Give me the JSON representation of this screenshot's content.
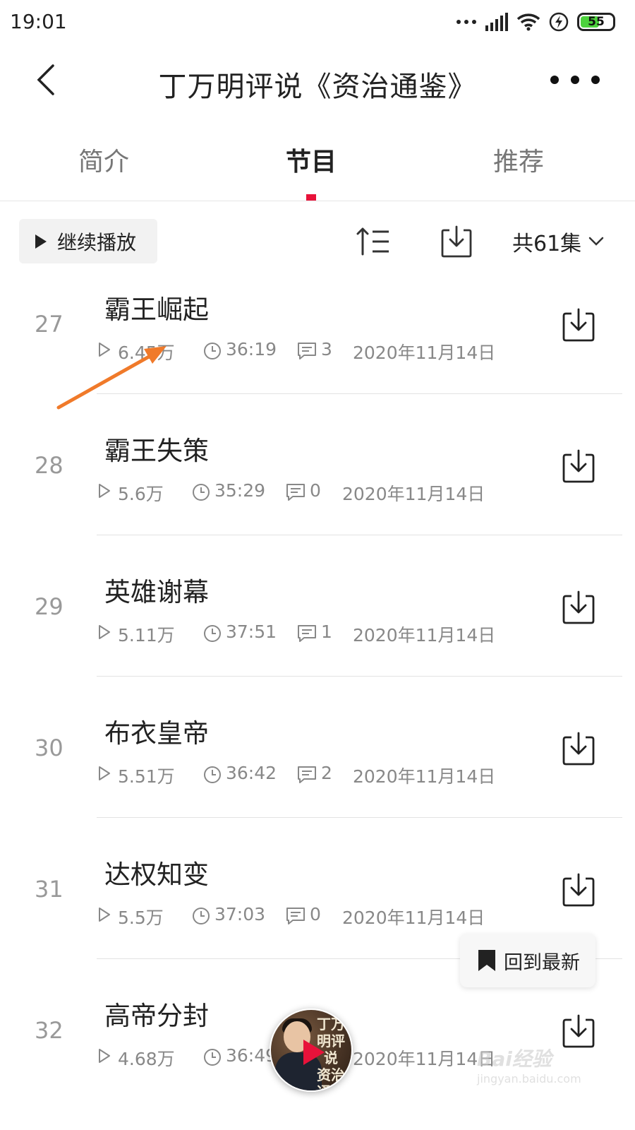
{
  "status_bar": {
    "time": "19:01",
    "battery": "55",
    "icons": [
      "dots-icon",
      "signal-icon",
      "wifi-icon",
      "charging-icon",
      "battery-icon"
    ]
  },
  "header": {
    "title": "丁万明评说《资治通鉴》",
    "back_icon": "back-chevron-icon",
    "more_icon": "more-dots-icon"
  },
  "tabs": [
    {
      "label": "简介",
      "active": false
    },
    {
      "label": "节目",
      "active": true
    },
    {
      "label": "推荐",
      "active": false
    }
  ],
  "toolbar": {
    "continue_label": "继续播放",
    "count_label": "共61集",
    "sort_icon": "sort-icon",
    "download_icon": "download-icon"
  },
  "episodes": [
    {
      "number": "27",
      "title": "霸王崛起",
      "plays": "6.45万",
      "duration": "36:19",
      "comments": "3",
      "date": "2020年11月14日"
    },
    {
      "number": "28",
      "title": "霸王失策",
      "plays": "5.6万",
      "duration": "35:29",
      "comments": "0",
      "date": "2020年11月14日"
    },
    {
      "number": "29",
      "title": "英雄谢幕",
      "plays": "5.11万",
      "duration": "37:51",
      "comments": "1",
      "date": "2020年11月14日"
    },
    {
      "number": "30",
      "title": "布衣皇帝",
      "plays": "5.51万",
      "duration": "36:42",
      "comments": "2",
      "date": "2020年11月14日"
    },
    {
      "number": "31",
      "title": "达权知变",
      "plays": "5.5万",
      "duration": "37:03",
      "comments": "0",
      "date": "2020年11月14日"
    },
    {
      "number": "32",
      "title": "高帝分封",
      "plays": "4.68万",
      "duration": "36:49",
      "comments": "",
      "date": "2020年11月14日"
    }
  ],
  "back_to_latest": {
    "label": "回到最新"
  },
  "player": {
    "cover_text": "丁万明评说 资治通鉴"
  },
  "watermark": {
    "logo": "Bai经验",
    "url": "jingyan.baidu.com"
  },
  "colors": {
    "accent": "#e8123a",
    "arrow": "#f07a2a",
    "battery": "#4cd23c"
  }
}
